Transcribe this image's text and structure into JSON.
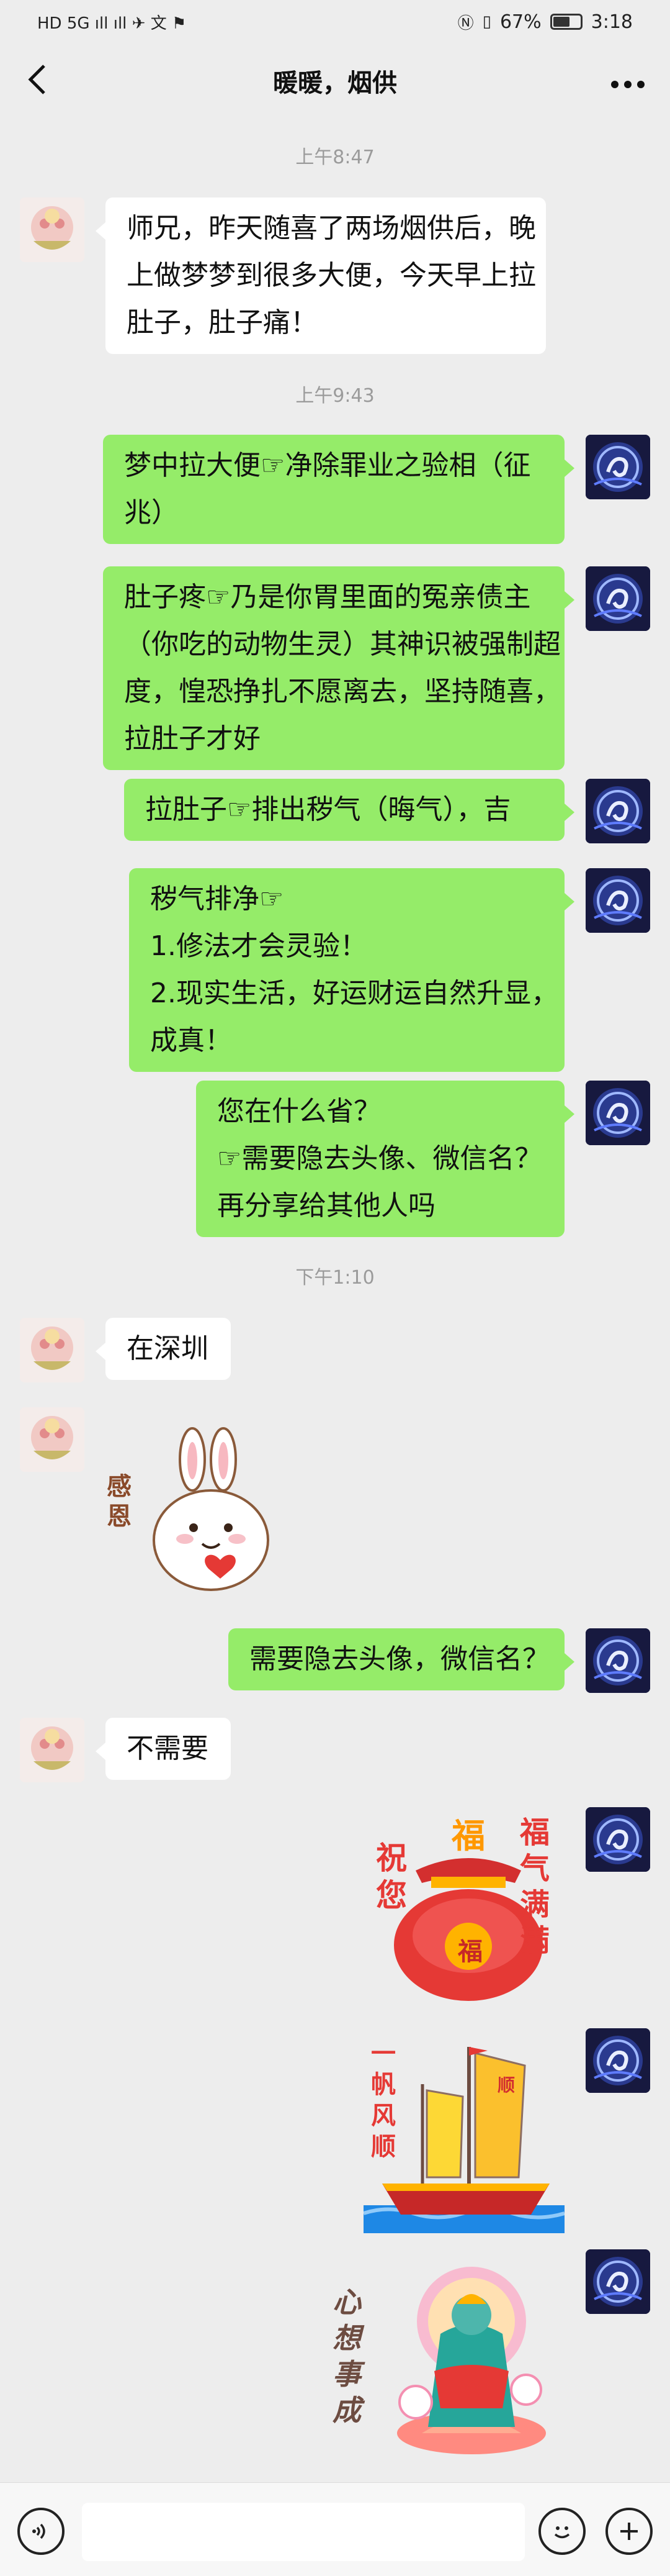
{
  "status_bar": {
    "left_icons": "HD 5G ıll ıll ✈ 文 ⚑",
    "battery_text": "67%",
    "battery_level": 0.67,
    "time": "3:18"
  },
  "header": {
    "title": "暖暖，烟供"
  },
  "messages": {
    "ts1": "上午8:47",
    "m1": [
      "师兄，昨天随喜了两场烟供后，晚",
      "上做梦梦到很多大便，今天早上拉",
      "肚子，肚子痛！"
    ],
    "ts2": "上午9:43",
    "m2": [
      "梦中拉大便☞净除罪业之验相（征",
      "兆）"
    ],
    "m3": [
      "肚子疼☞乃是你胃里面的冤亲债主",
      "（你吃的动物生灵）其神识被强制超",
      "度，惶恐挣扎不愿离去，坚持随喜，",
      "拉肚子才好"
    ],
    "m4": [
      "拉肚子☞排出秽气（晦气），吉"
    ],
    "m5": [
      "秽气排净☞",
      "1.修法才会灵验！",
      "2.现实生活，好运财运自然升显，",
      "成真！"
    ],
    "m6": [
      "您在什么省？",
      "☞需要隐去头像、微信名？",
      "再分享给其他人吗"
    ],
    "ts3": "下午1:10",
    "m7": [
      "在深圳"
    ],
    "sticker1_text": [
      "感",
      "恩"
    ],
    "m8": [
      "需要隐去头像，微信名？"
    ],
    "m9": [
      "不需要"
    ],
    "sticker2": {
      "left": "祝您",
      "top": "福",
      "right": "福气满满",
      "bag": "福"
    },
    "sticker3": {
      "text": "一帆风顺",
      "flag": "顺"
    },
    "sticker4": {
      "text": "心想事成"
    }
  },
  "colors": {
    "background": "#ededed",
    "incoming_bubble": "#ffffff",
    "outgoing_bubble": "#95ec69",
    "timestamp": "#9b9b9b"
  },
  "icons": {
    "back": "chevron-left-icon",
    "more": "more-dots-icon",
    "voice": "voice-icon",
    "emoji": "emoji-icon",
    "plus": "plus-icon"
  }
}
